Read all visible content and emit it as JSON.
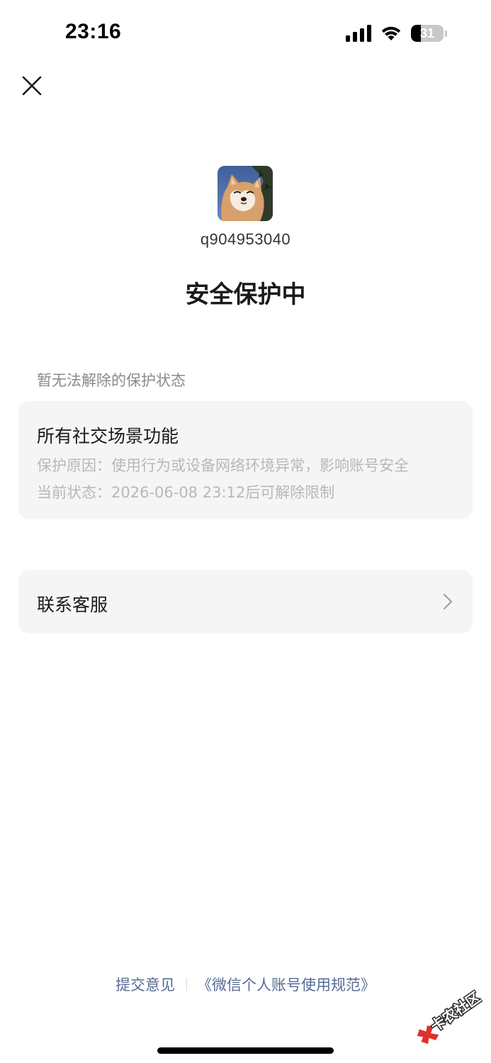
{
  "status_bar": {
    "time": "23:16",
    "battery_level": "31",
    "battery_fraction": 0.31
  },
  "header": {
    "close_icon": "close-icon"
  },
  "profile": {
    "account_id": "q904953040"
  },
  "title": "安全保护中",
  "section_label": "暂无法解除的保护状态",
  "protection": {
    "title": "所有社交场景功能",
    "reason": "保护原因：使用行为或设备网络环境异常，影响账号安全",
    "status": "当前状态：2026-06-08 23:12后可解除限制"
  },
  "contact": {
    "label": "联系客服"
  },
  "footer": {
    "feedback": "提交意见",
    "rules": "《微信个人账号使用规范》"
  },
  "watermark": {
    "text": "卡农社区"
  },
  "colors": {
    "link": "#576b95",
    "card_bg": "#f5f5f5",
    "secondary_text": "#b8b8b8"
  }
}
